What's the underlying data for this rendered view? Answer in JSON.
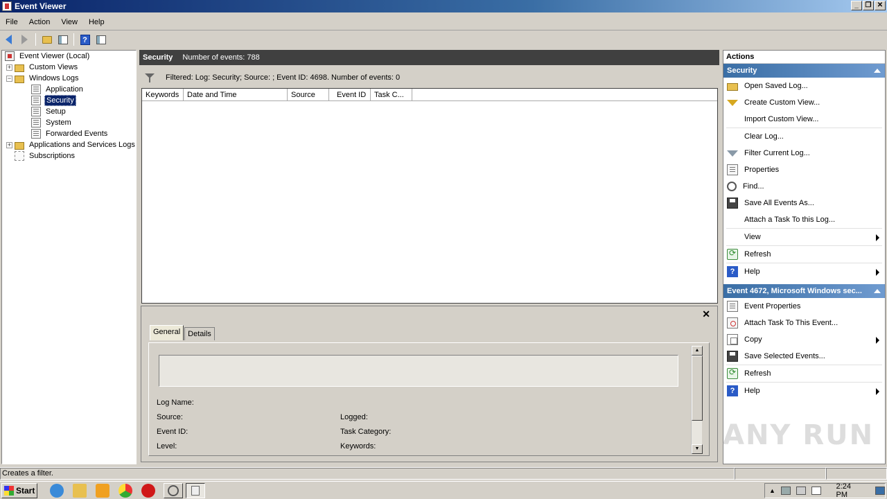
{
  "window": {
    "title": "Event Viewer",
    "buttons": [
      "_",
      "❐",
      "✕"
    ]
  },
  "menu": [
    "File",
    "Action",
    "View",
    "Help"
  ],
  "toolbar": {
    "icons": [
      "back-arrow-icon",
      "forward-arrow-icon",
      "folder-up-icon",
      "show-hide-tree-icon",
      "help-icon",
      "action-pane-icon"
    ]
  },
  "tree": {
    "root": "Event Viewer (Local)",
    "custom_views": "Custom Views",
    "windows_logs": "Windows Logs",
    "application": "Application",
    "security": "Security",
    "setup": "Setup",
    "system": "System",
    "forwarded": "Forwarded Events",
    "app_services": "Applications and Services Logs",
    "subscriptions": "Subscriptions"
  },
  "center": {
    "log_name": "Security",
    "events_count": "Number of events: 788",
    "filter_text": "Filtered: Log: Security; Source: ; Event ID: 4698. Number of events: 0",
    "columns": [
      "Keywords",
      "Date and Time",
      "Source",
      "Event ID",
      "Task C..."
    ]
  },
  "detail": {
    "close": "✕",
    "tabs": [
      "General",
      "Details"
    ],
    "fields": {
      "log_name": "Log Name:",
      "source": "Source:",
      "event_id": "Event ID:",
      "level": "Level:",
      "logged": "Logged:",
      "task_category": "Task Category:",
      "keywords": "Keywords:"
    }
  },
  "actions": {
    "header": "Actions",
    "section1": {
      "title": "Security",
      "items": [
        "Open Saved Log...",
        "Create Custom View...",
        "Import Custom View...",
        "Clear Log...",
        "Filter Current Log...",
        "Properties",
        "Find...",
        "Save All Events As...",
        "Attach a Task To this Log...",
        "View",
        "Refresh",
        "Help"
      ]
    },
    "section2": {
      "title": "Event 4672, Microsoft Windows sec...",
      "items": [
        "Event Properties",
        "Attach Task To This Event...",
        "Copy",
        "Save Selected Events...",
        "Refresh",
        "Help"
      ]
    }
  },
  "watermark": "ANY RUN",
  "status": {
    "text": "Creates a filter."
  },
  "taskbar": {
    "start": "Start",
    "time": "2:24 PM"
  }
}
